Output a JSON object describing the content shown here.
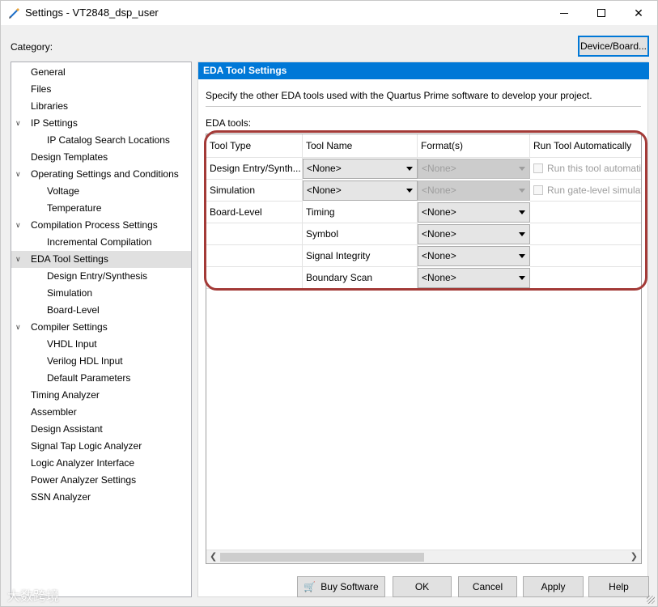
{
  "window": {
    "title": "Settings - VT2848_dsp_user",
    "minimize_glyph": "",
    "close_glyph": "✕"
  },
  "category_label": "Category:",
  "device_board_button": "Device/Board...",
  "tree": [
    {
      "label": "General",
      "level": 0,
      "expandable": false
    },
    {
      "label": "Files",
      "level": 0,
      "expandable": false
    },
    {
      "label": "Libraries",
      "level": 0,
      "expandable": false
    },
    {
      "label": "IP Settings",
      "level": 0,
      "expandable": true
    },
    {
      "label": "IP Catalog Search Locations",
      "level": 1,
      "expandable": false
    },
    {
      "label": "Design Templates",
      "level": 0,
      "expandable": false
    },
    {
      "label": "Operating Settings and Conditions",
      "level": 0,
      "expandable": true
    },
    {
      "label": "Voltage",
      "level": 1,
      "expandable": false
    },
    {
      "label": "Temperature",
      "level": 1,
      "expandable": false
    },
    {
      "label": "Compilation Process Settings",
      "level": 0,
      "expandable": true
    },
    {
      "label": "Incremental Compilation",
      "level": 1,
      "expandable": false
    },
    {
      "label": "EDA Tool Settings",
      "level": 0,
      "expandable": true,
      "selected": true
    },
    {
      "label": "Design Entry/Synthesis",
      "level": 1,
      "expandable": false
    },
    {
      "label": "Simulation",
      "level": 1,
      "expandable": false
    },
    {
      "label": "Board-Level",
      "level": 1,
      "expandable": false
    },
    {
      "label": "Compiler Settings",
      "level": 0,
      "expandable": true
    },
    {
      "label": "VHDL Input",
      "level": 1,
      "expandable": false
    },
    {
      "label": "Verilog HDL Input",
      "level": 1,
      "expandable": false
    },
    {
      "label": "Default Parameters",
      "level": 1,
      "expandable": false
    },
    {
      "label": "Timing Analyzer",
      "level": 0,
      "expandable": false
    },
    {
      "label": "Assembler",
      "level": 0,
      "expandable": false
    },
    {
      "label": "Design Assistant",
      "level": 0,
      "expandable": false
    },
    {
      "label": "Signal Tap Logic Analyzer",
      "level": 0,
      "expandable": false
    },
    {
      "label": "Logic Analyzer Interface",
      "level": 0,
      "expandable": false
    },
    {
      "label": "Power Analyzer Settings",
      "level": 0,
      "expandable": false
    },
    {
      "label": "SSN Analyzer",
      "level": 0,
      "expandable": false
    }
  ],
  "panel": {
    "header": "EDA Tool Settings",
    "description": "Specify the other EDA tools used with the Quartus Prime software to develop your project.",
    "eda_tools_label": "EDA tools:",
    "columns": [
      "Tool Type",
      "Tool Name",
      "Format(s)",
      "Run Tool Automatically"
    ],
    "rows": [
      {
        "tool_type": "Design Entry/Synth...",
        "tool_name": "<None>",
        "tool_name_dropdown": true,
        "format": "<None>",
        "format_disabled": true,
        "run": "Run this tool automatically"
      },
      {
        "tool_type": "Simulation",
        "tool_name": "<None>",
        "tool_name_dropdown": true,
        "format": "<None>",
        "format_disabled": true,
        "run": "Run gate-level simulation"
      },
      {
        "tool_type": "Board-Level",
        "tool_name": "Timing",
        "tool_name_dropdown": false,
        "format": "<None>",
        "format_disabled": false,
        "run": ""
      },
      {
        "tool_type": "",
        "tool_name": "Symbol",
        "tool_name_dropdown": false,
        "format": "<None>",
        "format_disabled": false,
        "run": ""
      },
      {
        "tool_type": "",
        "tool_name": "Signal Integrity",
        "tool_name_dropdown": false,
        "format": "<None>",
        "format_disabled": false,
        "run": ""
      },
      {
        "tool_type": "",
        "tool_name": "Boundary Scan",
        "tool_name_dropdown": false,
        "format": "<None>",
        "format_disabled": false,
        "run": ""
      }
    ]
  },
  "buttons": {
    "buy_software": "Buy Software",
    "ok": "OK",
    "cancel": "Cancel",
    "apply": "Apply",
    "help": "Help"
  },
  "watermark": "大数跨境",
  "colors": {
    "accent": "#0078d7",
    "highlight_ring": "#a33a37"
  }
}
